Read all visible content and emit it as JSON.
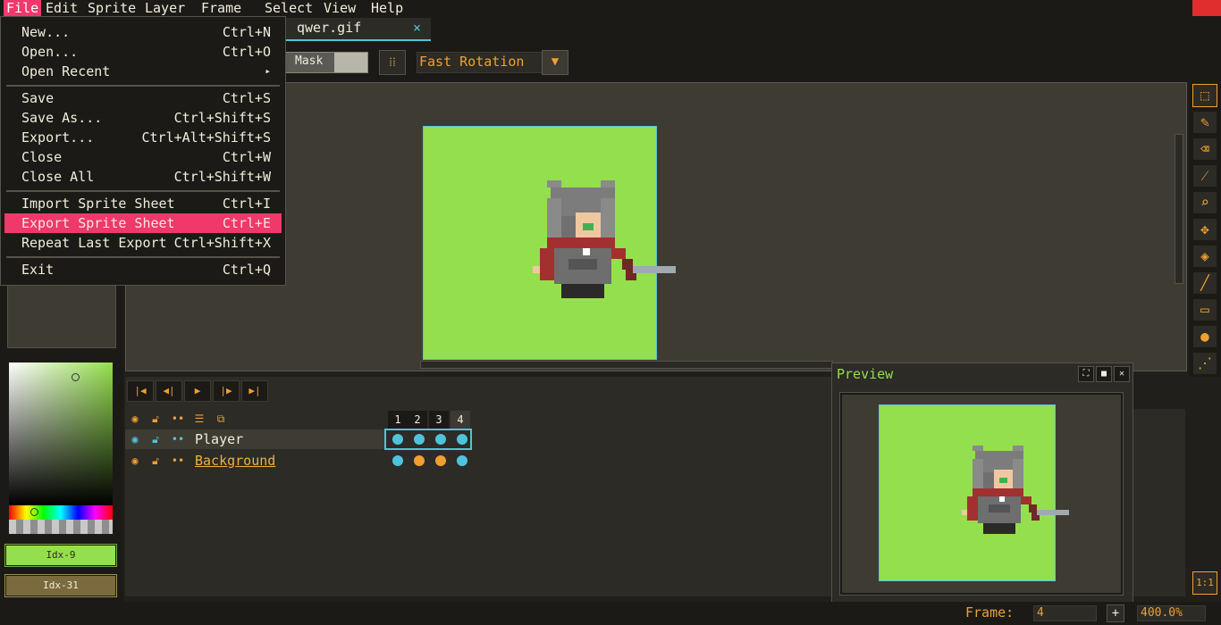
{
  "menubar": {
    "items": [
      "File",
      "Edit",
      "Sprite",
      "Layer",
      "Frame",
      "Select",
      "View",
      "Help"
    ]
  },
  "tab": {
    "label": "qwer.gif",
    "close": "×"
  },
  "toolbar": {
    "mask_label": "Mask",
    "rotation_value": "Fast Rotation"
  },
  "file_menu": {
    "items": [
      {
        "label": "New...",
        "shortcut": "Ctrl+N"
      },
      {
        "label": "Open...",
        "shortcut": "Ctrl+O"
      },
      {
        "label": "Open Recent",
        "shortcut": "▸"
      },
      {
        "label": "Save",
        "shortcut": "Ctrl+S"
      },
      {
        "label": "Save As...",
        "shortcut": "Ctrl+Shift+S"
      },
      {
        "label": "Export...",
        "shortcut": "Ctrl+Alt+Shift+S"
      },
      {
        "label": "Close",
        "shortcut": "Ctrl+W"
      },
      {
        "label": "Close All",
        "shortcut": "Ctrl+Shift+W"
      },
      {
        "label": "Import Sprite Sheet",
        "shortcut": "Ctrl+I"
      },
      {
        "label": "Export Sprite Sheet",
        "shortcut": "Ctrl+E"
      },
      {
        "label": "Repeat Last Export",
        "shortcut": "Ctrl+Shift+X"
      },
      {
        "label": "Exit",
        "shortcut": "Ctrl+Q"
      }
    ],
    "highlighted": "Export Sprite Sheet"
  },
  "colors": {
    "fg_label": "Idx-9",
    "bg_label": "Idx-31",
    "fg": "#94df4d",
    "bg": "#7b6a3e",
    "accent": "#f0a030",
    "highlight": "#f0386b",
    "selection": "#4fc3dc"
  },
  "timeline": {
    "frames": [
      "1",
      "2",
      "3",
      "4"
    ],
    "current_frame": "4",
    "layers": [
      {
        "name": "Player",
        "cels": [
          "cel",
          "cel",
          "cel",
          "cel"
        ]
      },
      {
        "name": "Background",
        "cels": [
          "cel",
          "linked",
          "linked",
          "cel"
        ]
      }
    ]
  },
  "preview": {
    "title": "Preview"
  },
  "status": {
    "frame_label": "Frame:",
    "frame_value": "4",
    "plus": "+",
    "zoom": "400.0%"
  },
  "tools": [
    "marquee-icon",
    "pencil-icon",
    "eraser-icon",
    "eyedropper-icon",
    "zoom-icon",
    "move-icon",
    "fill-icon",
    "line-icon",
    "rectangle-icon",
    "blur-icon",
    "spray-icon"
  ],
  "one_to_one": "1:1"
}
